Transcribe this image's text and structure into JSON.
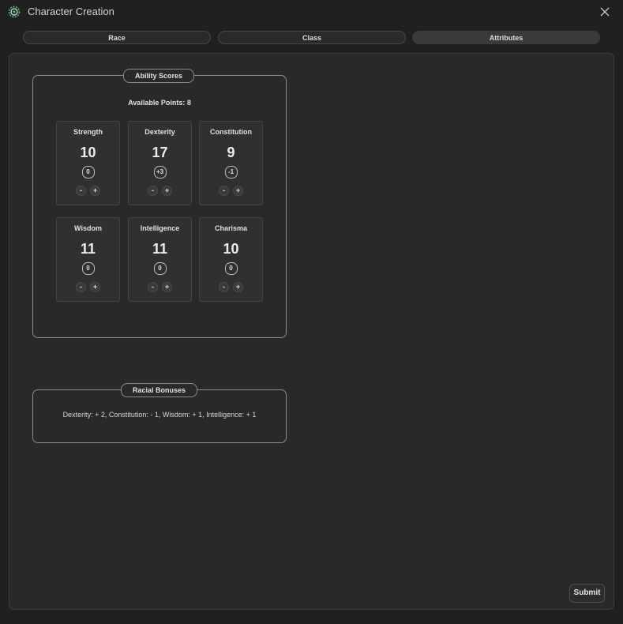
{
  "window": {
    "title": "Character Creation",
    "app_icon": "gear-icon",
    "close_icon": "close-icon"
  },
  "tabs": [
    {
      "label": "Race",
      "active": false
    },
    {
      "label": "Class",
      "active": false
    },
    {
      "label": "Attributes",
      "active": true
    }
  ],
  "ability_scores": {
    "legend": "Ability Scores",
    "available_points": "Available Points: 8",
    "minus_label": "-",
    "plus_label": "+",
    "abilities": [
      {
        "name": "Strength",
        "value": "10",
        "modifier": "0"
      },
      {
        "name": "Dexterity",
        "value": "17",
        "modifier": "+3"
      },
      {
        "name": "Constitution",
        "value": "9",
        "modifier": "-1"
      },
      {
        "name": "Wisdom",
        "value": "11",
        "modifier": "0"
      },
      {
        "name": "Intelligence",
        "value": "11",
        "modifier": "0"
      },
      {
        "name": "Charisma",
        "value": "10",
        "modifier": "0"
      }
    ]
  },
  "racial_bonuses": {
    "legend": "Racial Bonuses",
    "text": "Dexterity: + 2, Constitution: - 1, Wisdom: + 1, Intelligence: + 1"
  },
  "submit_label": "Submit",
  "colors": {
    "background": "#202020",
    "panel": "#292929",
    "accent_icon": "#3fbf6f"
  }
}
